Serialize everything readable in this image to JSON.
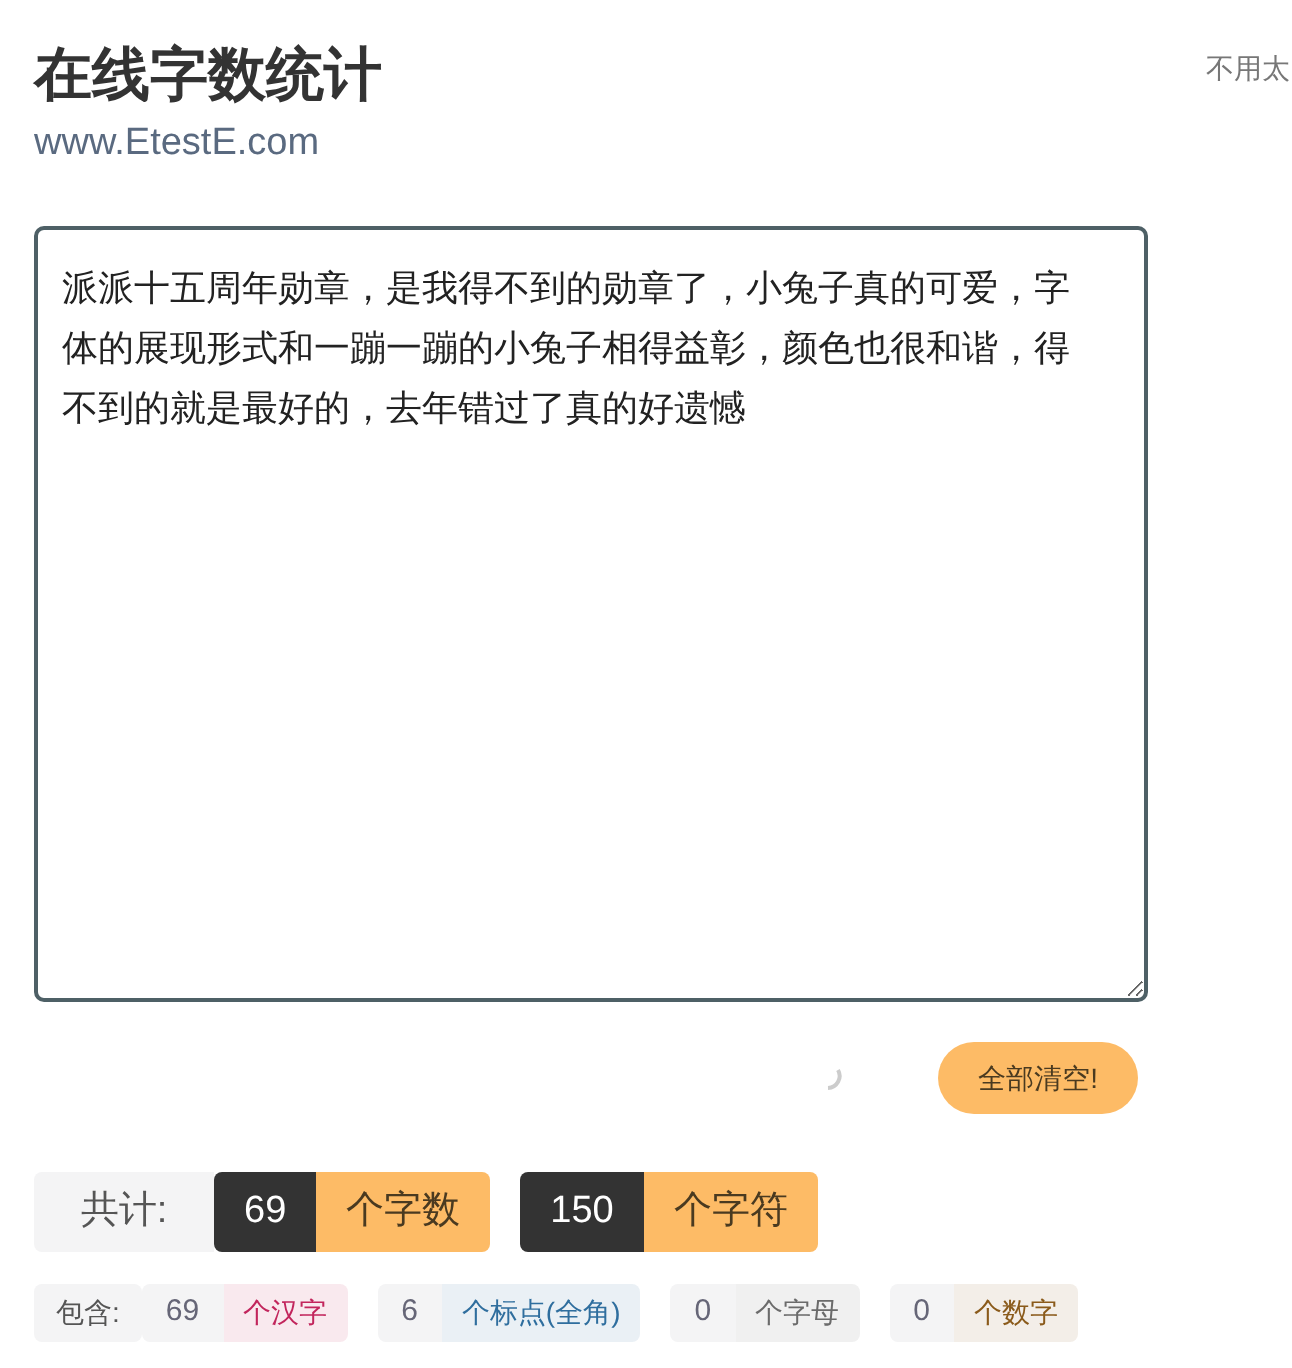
{
  "header": {
    "title": "在线字数统计",
    "subtitle": "www.EtestE.com",
    "side_note": "不用太"
  },
  "editor": {
    "value": "派派十五周年勋章，是我得不到的勋章了，小兔子真的可爱，字体的展现形式和一蹦一蹦的小兔子相得益彰，颜色也很和谐，得不到的就是最好的，去年错过了真的好遗憾"
  },
  "clear_button": "全部清空!",
  "totals": {
    "label": "共计:",
    "items": [
      {
        "count": "69",
        "unit": "个字数"
      },
      {
        "count": "150",
        "unit": "个字符"
      }
    ]
  },
  "breakdown": {
    "label": "包含:",
    "items": [
      {
        "count": "69",
        "unit": "个汉字",
        "color": "#c2255c"
      },
      {
        "count": "6",
        "unit": "个标点(全角)",
        "color": "#2f6e9e"
      },
      {
        "count": "0",
        "unit": "个字母",
        "color": "#6b6b6b"
      },
      {
        "count": "0",
        "unit": "个数字",
        "color": "#8a5a1a"
      }
    ]
  }
}
